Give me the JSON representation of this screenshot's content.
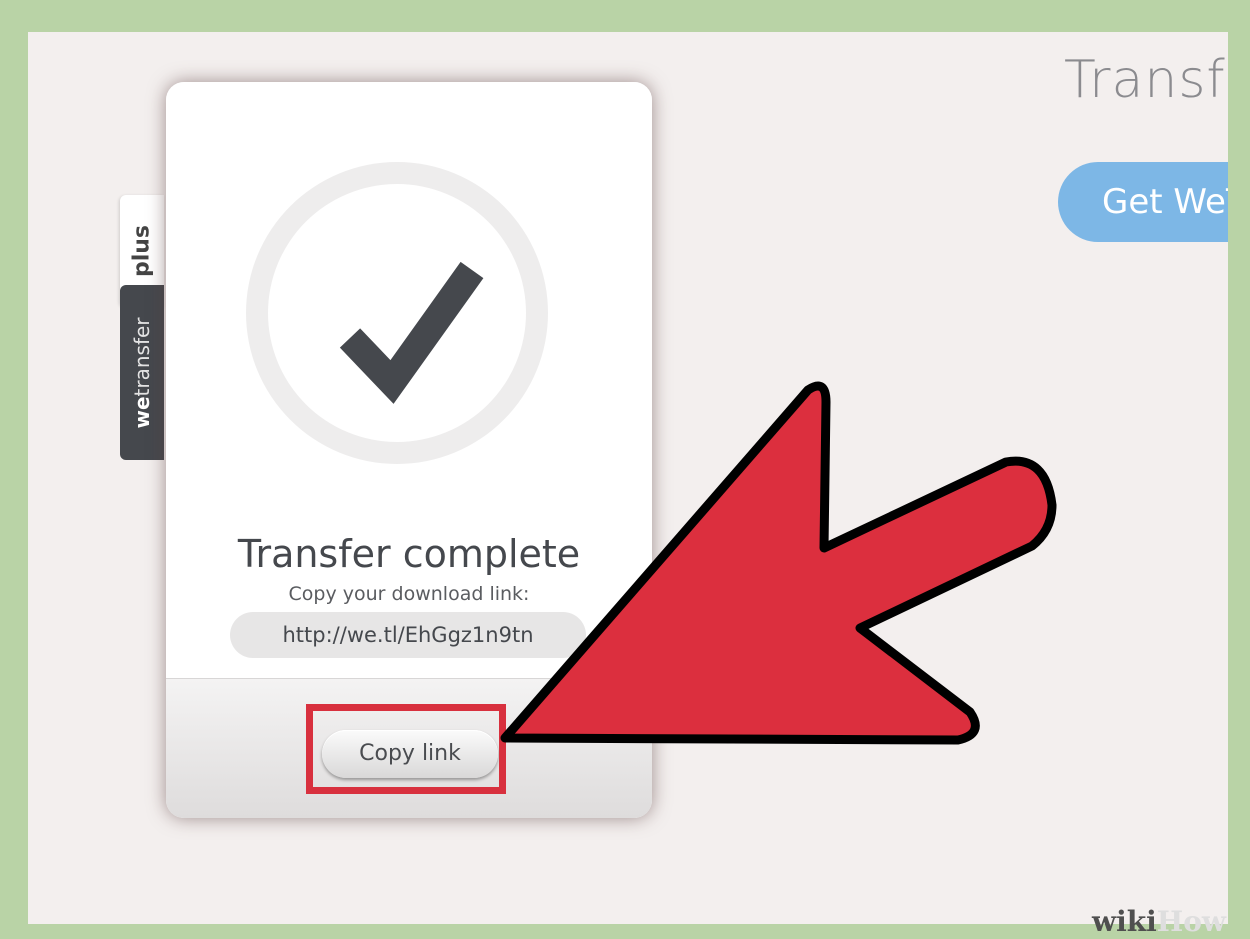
{
  "page": {
    "heading": "Transfer",
    "get_button_label": "Get WeTransfer Plus"
  },
  "side_tabs": {
    "plus_label": "plus",
    "brand_bold": "we",
    "brand_rest": "transfer"
  },
  "card": {
    "status_icon": "checkmark-icon",
    "title": "Transfer complete",
    "subtitle": "Copy your download link:",
    "link_url": "http://we.tl/EhGgz1n9tn",
    "copy_button_label": "Copy link"
  },
  "annotation": {
    "arrow_color": "#dc2f3e",
    "highlight_color": "#d8303e"
  },
  "watermark": {
    "part1": "wiki",
    "part2": "How"
  }
}
